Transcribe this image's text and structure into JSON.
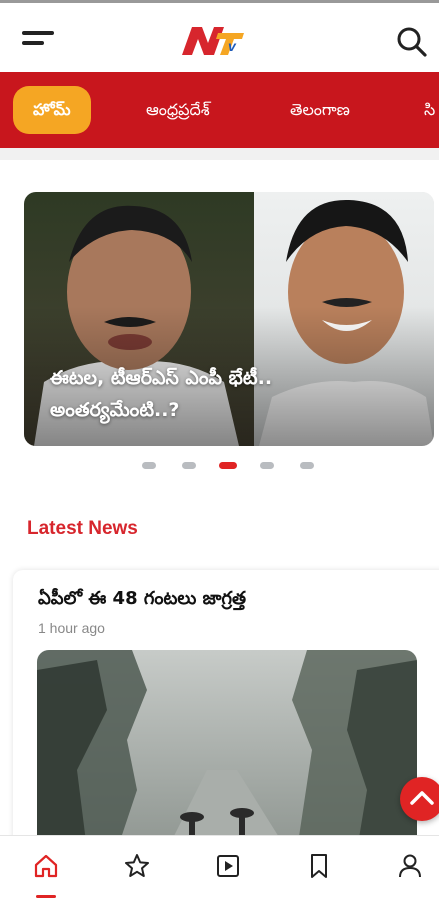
{
  "header": {
    "logo_text": "NTV",
    "menu_icon": "hamburger-menu-icon",
    "search_icon": "search-icon"
  },
  "categories": [
    {
      "label": "హోమ్",
      "active": true
    },
    {
      "label": "ఆంధ్రప్రదేశ్",
      "active": false
    },
    {
      "label": "తెలంగాణ",
      "active": false
    },
    {
      "label": "సి",
      "active": false
    }
  ],
  "slider": {
    "caption": "ఈటల, టీఆర్ఎస్ ఎంపీ భేటీ.. అంతర్యమేంటి..?",
    "dots_total": 5,
    "active_dot": 3
  },
  "latest": {
    "title": "Latest News",
    "articles": [
      {
        "title": "ఏపీలో ఈ 48 గంటలు జాగ్రత్త",
        "time": "1 hour ago"
      }
    ]
  },
  "fab": {
    "icon": "chevron-up-icon"
  },
  "bottom_nav": [
    {
      "icon": "home-icon",
      "active": true
    },
    {
      "icon": "star-icon",
      "active": false
    },
    {
      "icon": "video-play-icon",
      "active": false
    },
    {
      "icon": "bookmark-icon",
      "active": false
    },
    {
      "icon": "user-icon",
      "active": false
    }
  ],
  "colors": {
    "brand_red": "#c8161d",
    "active_tab": "#f5a623",
    "accent_red": "#e02424"
  }
}
